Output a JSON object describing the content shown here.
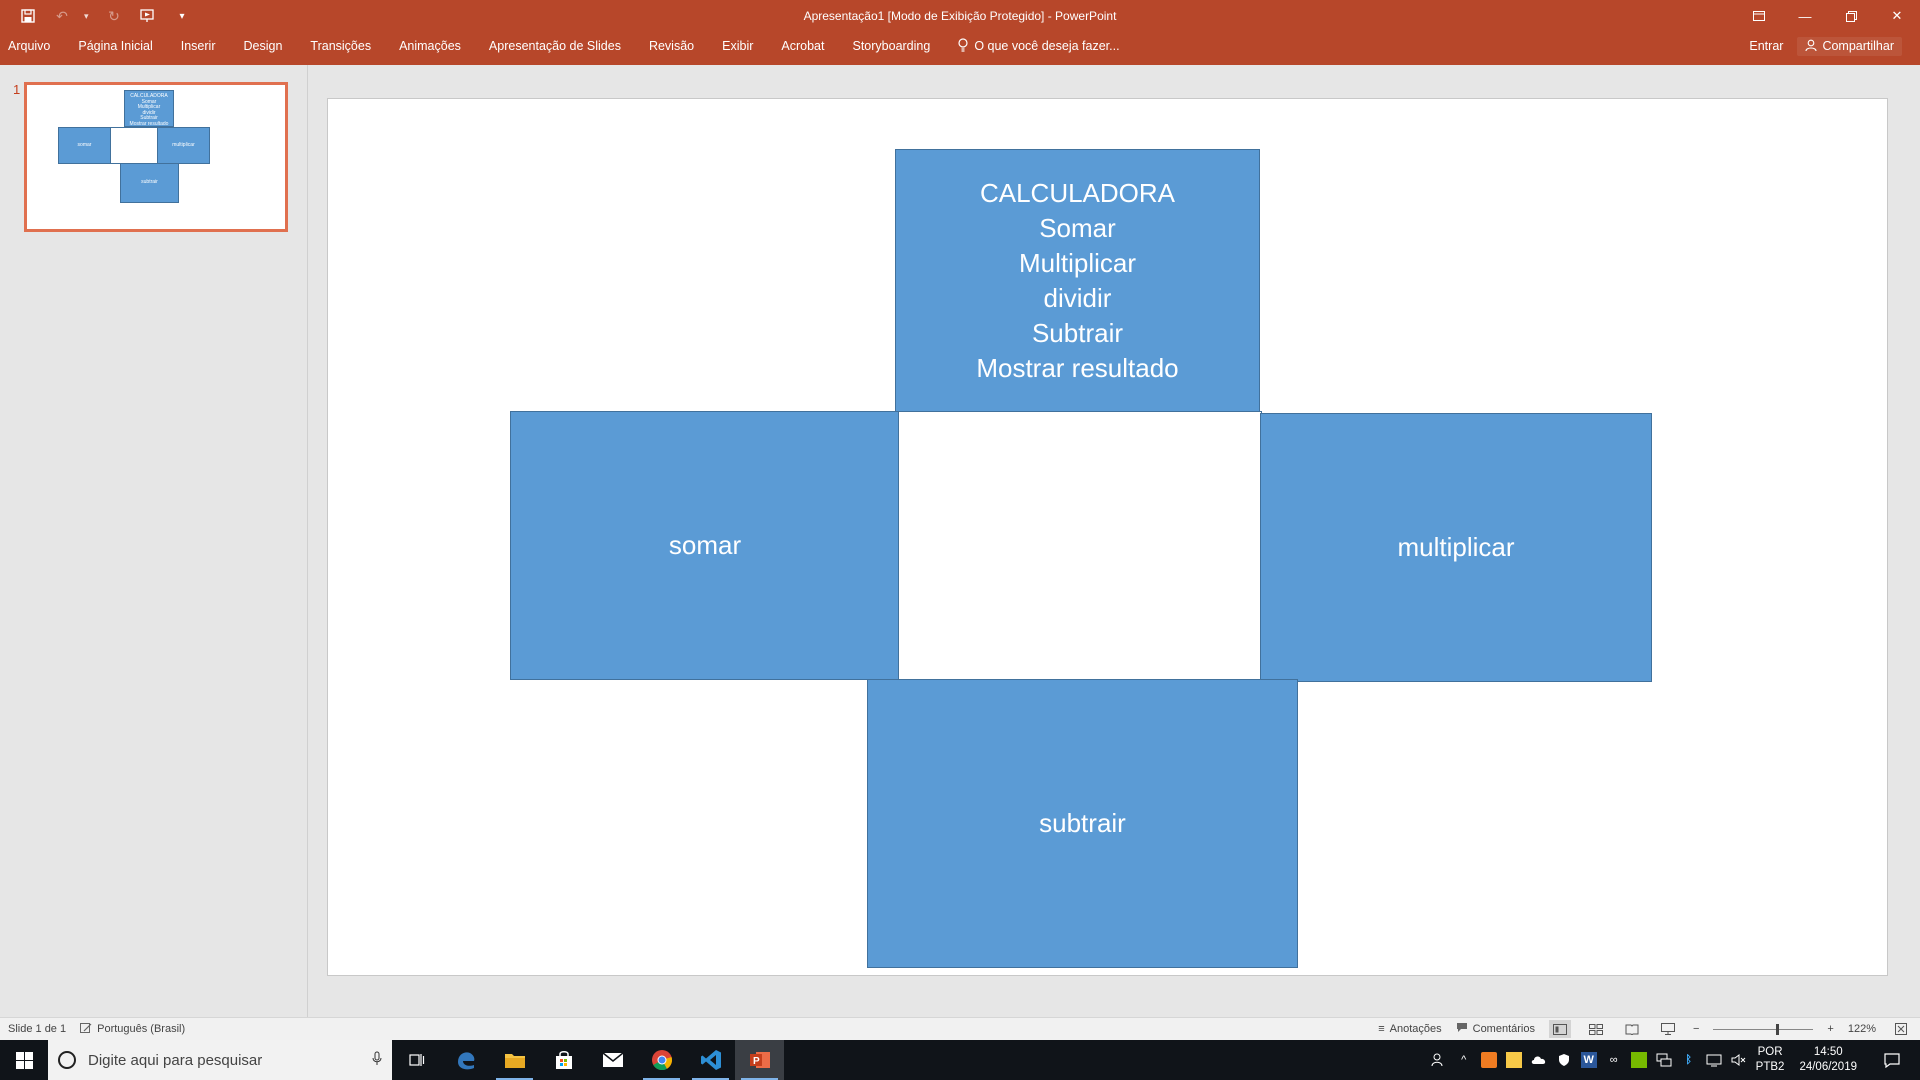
{
  "window": {
    "title": "Apresentação1 [Modo de Exibição Protegido] - PowerPoint",
    "brand_color": "#b7472a"
  },
  "qat": {
    "save_icon": "save-icon",
    "undo_icon": "undo-icon",
    "redo_icon": "redo-icon",
    "present_icon": "present-from-start-icon",
    "customize_icon": "customize-qat-icon"
  },
  "ribbon": {
    "tabs": [
      "Arquivo",
      "Página Inicial",
      "Inserir",
      "Design",
      "Transições",
      "Animações",
      "Apresentação de Slides",
      "Revisão",
      "Exibir",
      "Acrobat",
      "Storyboarding"
    ],
    "tell_me": "O que você deseja fazer...",
    "sign_in": "Entrar",
    "share": "Compartilhar"
  },
  "thumbnails": {
    "items": [
      {
        "number": "1",
        "selected": true,
        "top_lines": [
          "CALCULADORA",
          "Somar",
          "Multiplicar",
          "dividir",
          "Subtrair",
          "Mostrar resultado"
        ],
        "left": "somar",
        "right": "multiplicar",
        "bottom": "subtrair"
      }
    ]
  },
  "slide": {
    "shape_fill": "#5b9bd5",
    "shape_border": "#41719c",
    "top_box_lines": [
      "CALCULADORA",
      "Somar",
      "Multiplicar",
      "dividir",
      "Subtrair",
      "Mostrar resultado"
    ],
    "left_box": "somar",
    "right_box": "multiplicar",
    "bottom_box": "subtrair"
  },
  "statusbar": {
    "slide_counter": "Slide 1 de 1",
    "language": "Português (Brasil)",
    "notes": "Anotações",
    "comments": "Comentários",
    "zoom": "122%",
    "zoom_minus": "−",
    "zoom_plus": "+"
  },
  "taskbar": {
    "search_placeholder": "Digite aqui para pesquisar",
    "apps": [
      "task-view-icon",
      "edge-icon",
      "file-explorer-icon",
      "store-icon",
      "mail-icon",
      "chrome-icon",
      "vscode-icon",
      "powerpoint-icon"
    ],
    "language_line1": "POR",
    "language_line2": "PTB2",
    "time": "14:50",
    "date": "24/06/2019"
  }
}
